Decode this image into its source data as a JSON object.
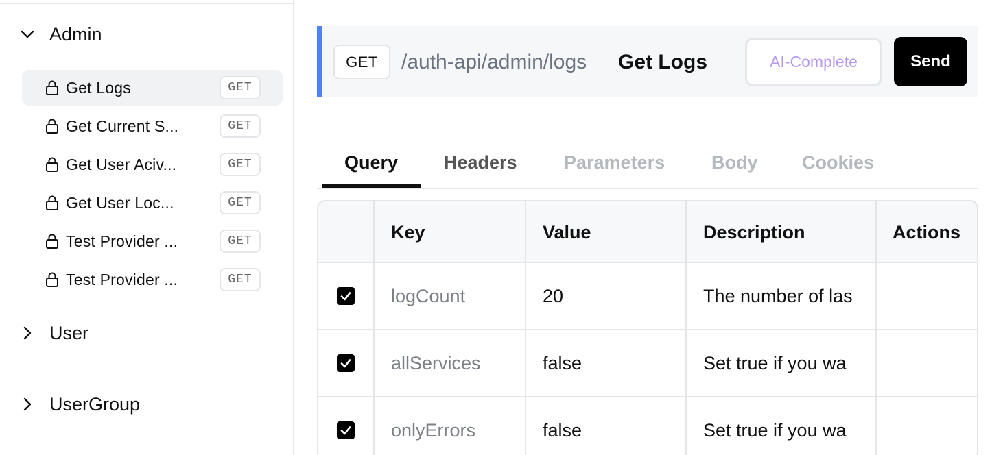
{
  "sidebar": {
    "groups": [
      {
        "label": "Admin",
        "expanded": true
      },
      {
        "label": "User",
        "expanded": false
      },
      {
        "label": "UserGroup",
        "expanded": false
      }
    ],
    "items": [
      {
        "label": "Get Logs",
        "method": "GET",
        "active": true
      },
      {
        "label": "Get Current S...",
        "method": "GET"
      },
      {
        "label": "Get User Aciv...",
        "method": "GET"
      },
      {
        "label": "Get User Loc...",
        "method": "GET"
      },
      {
        "label": "Test Provider ...",
        "method": "GET"
      },
      {
        "label": "Test Provider ...",
        "method": "GET"
      }
    ]
  },
  "request": {
    "method": "GET",
    "path": "/auth-api/admin/logs",
    "name": "Get Logs",
    "ai_complete_label": "AI-Complete",
    "send_label": "Send"
  },
  "tabs": [
    {
      "label": "Query",
      "state": "active"
    },
    {
      "label": "Headers",
      "state": "normal"
    },
    {
      "label": "Parameters",
      "state": "disabled"
    },
    {
      "label": "Body",
      "state": "disabled"
    },
    {
      "label": "Cookies",
      "state": "disabled"
    }
  ],
  "table": {
    "headers": {
      "key": "Key",
      "value": "Value",
      "description": "Description",
      "actions": "Actions"
    },
    "rows": [
      {
        "checked": true,
        "key": "logCount",
        "value": "20",
        "description": "The number of las"
      },
      {
        "checked": true,
        "key": "allServices",
        "value": "false",
        "description": "Set true if you wa"
      },
      {
        "checked": true,
        "key": "onlyErrors",
        "value": "false",
        "description": "Set true if you wa"
      }
    ]
  },
  "colors": {
    "accent": "#4f83f5",
    "ai_text": "#b69af0",
    "send_bg": "#000000"
  },
  "icons": [
    "chevron-down-icon",
    "chevron-right-icon",
    "lock-icon",
    "checkbox-checked-icon"
  ]
}
